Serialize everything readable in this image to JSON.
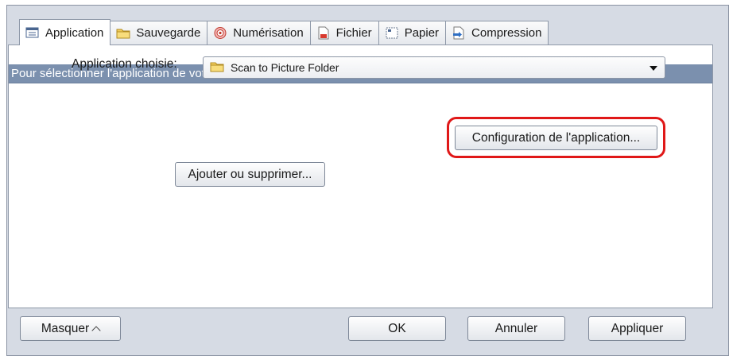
{
  "tabs": [
    {
      "label": "Application",
      "icon": "application-list-icon"
    },
    {
      "label": "Sauvegarde",
      "icon": "folder-icon"
    },
    {
      "label": "Numérisation",
      "icon": "scan-icon"
    },
    {
      "label": "Fichier",
      "icon": "file-icon"
    },
    {
      "label": "Papier",
      "icon": "paper-icon"
    },
    {
      "label": "Compression",
      "icon": "compression-icon"
    }
  ],
  "active_tab": "Application",
  "banner": "Pour sélectionner l'application de votre choix.",
  "application": {
    "label": "Application choisie:",
    "selected": "Scan to Picture Folder"
  },
  "buttons": {
    "config": "Configuration de l'application...",
    "add_remove": "Ajouter ou supprimer..."
  },
  "footer": {
    "hide": "Masquer",
    "ok": "OK",
    "cancel": "Annuler",
    "apply": "Appliquer"
  },
  "colors": {
    "banner": "#7b90ae",
    "highlight": "#e01818",
    "window": "#d6dbe4"
  }
}
